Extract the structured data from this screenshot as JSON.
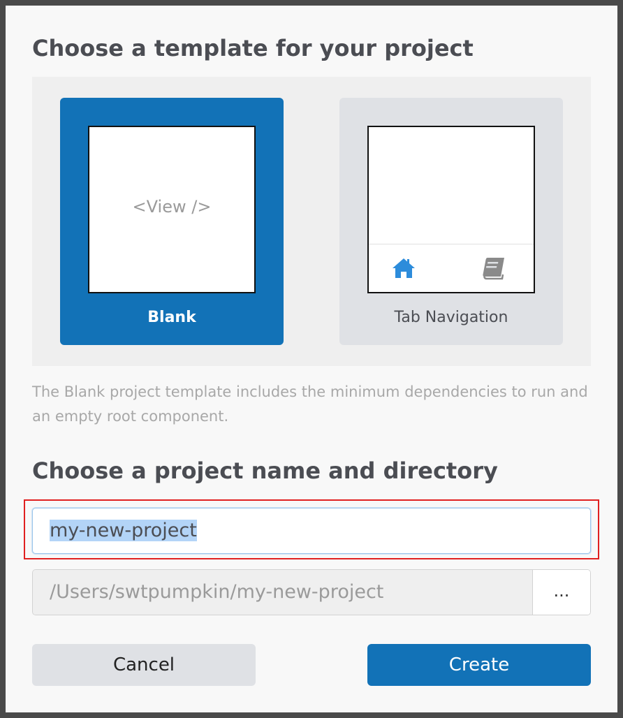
{
  "dialog": {
    "template_heading": "Choose a template for your project",
    "templates": [
      {
        "label": "Blank",
        "preview_text": "<View />",
        "selected": true
      },
      {
        "label": "Tab Navigation",
        "icons": [
          "home-icon",
          "book-icon"
        ],
        "selected": false
      }
    ],
    "description": "The Blank project template includes the minimum dependencies to run and an empty root component.",
    "name_heading": "Choose a project name and directory",
    "project_name": "my-new-project",
    "directory": "/Users/swtpumpkin/my-new-project",
    "browse_label": "...",
    "cancel_label": "Cancel",
    "create_label": "Create"
  },
  "colors": {
    "accent": "#1272b7",
    "tab_icon_active": "#2d8cdb",
    "tab_icon_inactive": "#8a8a8a",
    "highlight": "#e02020"
  }
}
